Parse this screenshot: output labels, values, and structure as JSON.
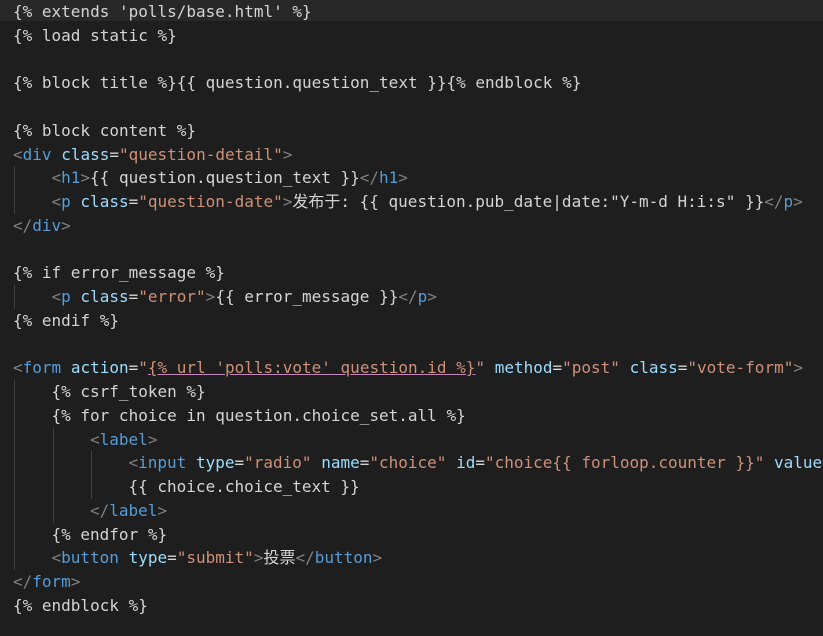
{
  "editor": {
    "colors": {
      "background": "#1e1e1e",
      "current_line": "#282828",
      "template": "#d4d4d4",
      "tag": "#569cd6",
      "bracket": "#808080",
      "attribute": "#9cdcfe",
      "string": "#ce9178",
      "text": "#d4d4d4",
      "indent_guide": "#404040"
    },
    "lines": [
      {
        "indent": 0,
        "tokens": [
          {
            "t": "tpl",
            "v": "{% extends 'polls/base.html' %}"
          }
        ]
      },
      {
        "indent": 0,
        "tokens": [
          {
            "t": "tpl",
            "v": "{% load static %}"
          }
        ]
      },
      {
        "indent": 0,
        "tokens": []
      },
      {
        "indent": 0,
        "tokens": [
          {
            "t": "tpl",
            "v": "{% block title %}{{ question.question_text }}{% endblock %}"
          }
        ]
      },
      {
        "indent": 0,
        "tokens": []
      },
      {
        "indent": 0,
        "tokens": [
          {
            "t": "tpl",
            "v": "{% block content %}"
          }
        ]
      },
      {
        "indent": 0,
        "tokens": [
          {
            "t": "brk",
            "v": "<"
          },
          {
            "t": "tag",
            "v": "div"
          },
          {
            "t": "txt",
            "v": " "
          },
          {
            "t": "attr",
            "v": "class"
          },
          {
            "t": "txt",
            "v": "="
          },
          {
            "t": "str",
            "v": "\"question-detail\""
          },
          {
            "t": "brk",
            "v": ">"
          }
        ]
      },
      {
        "indent": 1,
        "tokens": [
          {
            "t": "brk",
            "v": "<"
          },
          {
            "t": "tag",
            "v": "h1"
          },
          {
            "t": "brk",
            "v": ">"
          },
          {
            "t": "txt",
            "v": "{{ question.question_text }}"
          },
          {
            "t": "brk",
            "v": "</"
          },
          {
            "t": "tag",
            "v": "h1"
          },
          {
            "t": "brk",
            "v": ">"
          }
        ]
      },
      {
        "indent": 1,
        "tokens": [
          {
            "t": "brk",
            "v": "<"
          },
          {
            "t": "tag",
            "v": "p"
          },
          {
            "t": "txt",
            "v": " "
          },
          {
            "t": "attr",
            "v": "class"
          },
          {
            "t": "txt",
            "v": "="
          },
          {
            "t": "str",
            "v": "\"question-date\""
          },
          {
            "t": "brk",
            "v": ">"
          },
          {
            "t": "txt",
            "v": "发布于: {{ question.pub_date|date:\"Y-m-d H:i:s\" }}"
          },
          {
            "t": "brk",
            "v": "</"
          },
          {
            "t": "tag",
            "v": "p"
          },
          {
            "t": "brk",
            "v": ">"
          }
        ]
      },
      {
        "indent": 0,
        "tokens": [
          {
            "t": "brk",
            "v": "</"
          },
          {
            "t": "tag",
            "v": "div"
          },
          {
            "t": "brk",
            "v": ">"
          }
        ]
      },
      {
        "indent": 0,
        "tokens": []
      },
      {
        "indent": 0,
        "tokens": [
          {
            "t": "tpl",
            "v": "{% if error_message %}"
          }
        ]
      },
      {
        "indent": 1,
        "tokens": [
          {
            "t": "brk",
            "v": "<"
          },
          {
            "t": "tag",
            "v": "p"
          },
          {
            "t": "txt",
            "v": " "
          },
          {
            "t": "attr",
            "v": "class"
          },
          {
            "t": "txt",
            "v": "="
          },
          {
            "t": "str",
            "v": "\"error\""
          },
          {
            "t": "brk",
            "v": ">"
          },
          {
            "t": "txt",
            "v": "{{ error_message }}"
          },
          {
            "t": "brk",
            "v": "</"
          },
          {
            "t": "tag",
            "v": "p"
          },
          {
            "t": "brk",
            "v": ">"
          }
        ]
      },
      {
        "indent": 0,
        "tokens": [
          {
            "t": "tpl",
            "v": "{% endif %}"
          }
        ]
      },
      {
        "indent": 0,
        "tokens": []
      },
      {
        "indent": 0,
        "tokens": [
          {
            "t": "brk",
            "v": "<"
          },
          {
            "t": "tag",
            "v": "form"
          },
          {
            "t": "txt",
            "v": " "
          },
          {
            "t": "attr",
            "v": "action"
          },
          {
            "t": "txt",
            "v": "="
          },
          {
            "t": "str",
            "v": "\""
          },
          {
            "t": "str-link",
            "v": "{% url 'polls:vote' question.id %}"
          },
          {
            "t": "str",
            "v": "\""
          },
          {
            "t": "txt",
            "v": " "
          },
          {
            "t": "attr",
            "v": "method"
          },
          {
            "t": "txt",
            "v": "="
          },
          {
            "t": "str",
            "v": "\"post\""
          },
          {
            "t": "txt",
            "v": " "
          },
          {
            "t": "attr",
            "v": "class"
          },
          {
            "t": "txt",
            "v": "="
          },
          {
            "t": "str",
            "v": "\"vote-form\""
          },
          {
            "t": "brk",
            "v": ">"
          }
        ]
      },
      {
        "indent": 1,
        "tokens": [
          {
            "t": "tpl",
            "v": "{% csrf_token %}"
          }
        ]
      },
      {
        "indent": 1,
        "tokens": [
          {
            "t": "tpl",
            "v": "{% for choice in question.choice_set.all %}"
          }
        ]
      },
      {
        "indent": 2,
        "tokens": [
          {
            "t": "brk",
            "v": "<"
          },
          {
            "t": "tag",
            "v": "label"
          },
          {
            "t": "brk",
            "v": ">"
          }
        ]
      },
      {
        "indent": 3,
        "tokens": [
          {
            "t": "brk",
            "v": "<"
          },
          {
            "t": "tag",
            "v": "input"
          },
          {
            "t": "txt",
            "v": " "
          },
          {
            "t": "attr",
            "v": "type"
          },
          {
            "t": "txt",
            "v": "="
          },
          {
            "t": "str",
            "v": "\"radio\""
          },
          {
            "t": "txt",
            "v": " "
          },
          {
            "t": "attr",
            "v": "name"
          },
          {
            "t": "txt",
            "v": "="
          },
          {
            "t": "str",
            "v": "\"choice\""
          },
          {
            "t": "txt",
            "v": " "
          },
          {
            "t": "attr",
            "v": "id"
          },
          {
            "t": "txt",
            "v": "="
          },
          {
            "t": "str",
            "v": "\"choice{{ forloop.counter }}\""
          },
          {
            "t": "txt",
            "v": " "
          },
          {
            "t": "attr",
            "v": "value="
          }
        ]
      },
      {
        "indent": 3,
        "tokens": [
          {
            "t": "txt",
            "v": "{{ choice.choice_text }}"
          }
        ]
      },
      {
        "indent": 2,
        "tokens": [
          {
            "t": "brk",
            "v": "</"
          },
          {
            "t": "tag",
            "v": "label"
          },
          {
            "t": "brk",
            "v": ">"
          }
        ]
      },
      {
        "indent": 1,
        "tokens": [
          {
            "t": "tpl",
            "v": "{% endfor %}"
          }
        ]
      },
      {
        "indent": 1,
        "tokens": [
          {
            "t": "brk",
            "v": "<"
          },
          {
            "t": "tag",
            "v": "button"
          },
          {
            "t": "txt",
            "v": " "
          },
          {
            "t": "attr",
            "v": "type"
          },
          {
            "t": "txt",
            "v": "="
          },
          {
            "t": "str",
            "v": "\"submit\""
          },
          {
            "t": "brk",
            "v": ">"
          },
          {
            "t": "txt",
            "v": "投票"
          },
          {
            "t": "brk",
            "v": "</"
          },
          {
            "t": "tag",
            "v": "button"
          },
          {
            "t": "brk",
            "v": ">"
          }
        ]
      },
      {
        "indent": 0,
        "tokens": [
          {
            "t": "brk",
            "v": "</"
          },
          {
            "t": "tag",
            "v": "form"
          },
          {
            "t": "brk",
            "v": ">"
          }
        ]
      },
      {
        "indent": 0,
        "tokens": [
          {
            "t": "tpl",
            "v": "{% endblock %}"
          }
        ]
      }
    ]
  }
}
